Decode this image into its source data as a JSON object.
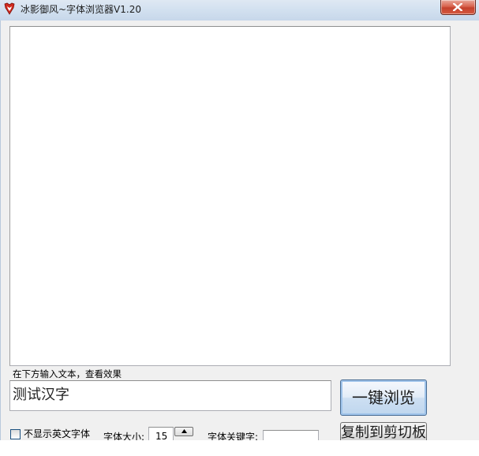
{
  "window": {
    "title": "冰影御风~字体浏览器V1.20",
    "app_icon": "app-logo-icon",
    "close_icon": "close-icon"
  },
  "preview": {
    "content": ""
  },
  "input_hint": "在下方输入文本，查看效果",
  "text_input": {
    "value": "测试汉字"
  },
  "buttons": {
    "browse_label": "一键浏览",
    "copy_label": "复制到剪切板"
  },
  "options": {
    "hide_english_label": "不显示英文字体",
    "hide_english_checked": false,
    "font_size_label": "字体大小:",
    "font_size_value": "15",
    "keyword_label": "字体关键字:",
    "keyword_value": ""
  },
  "colors": {
    "close_button": "#c4412d",
    "primary_button_border": "#4a6d94"
  }
}
